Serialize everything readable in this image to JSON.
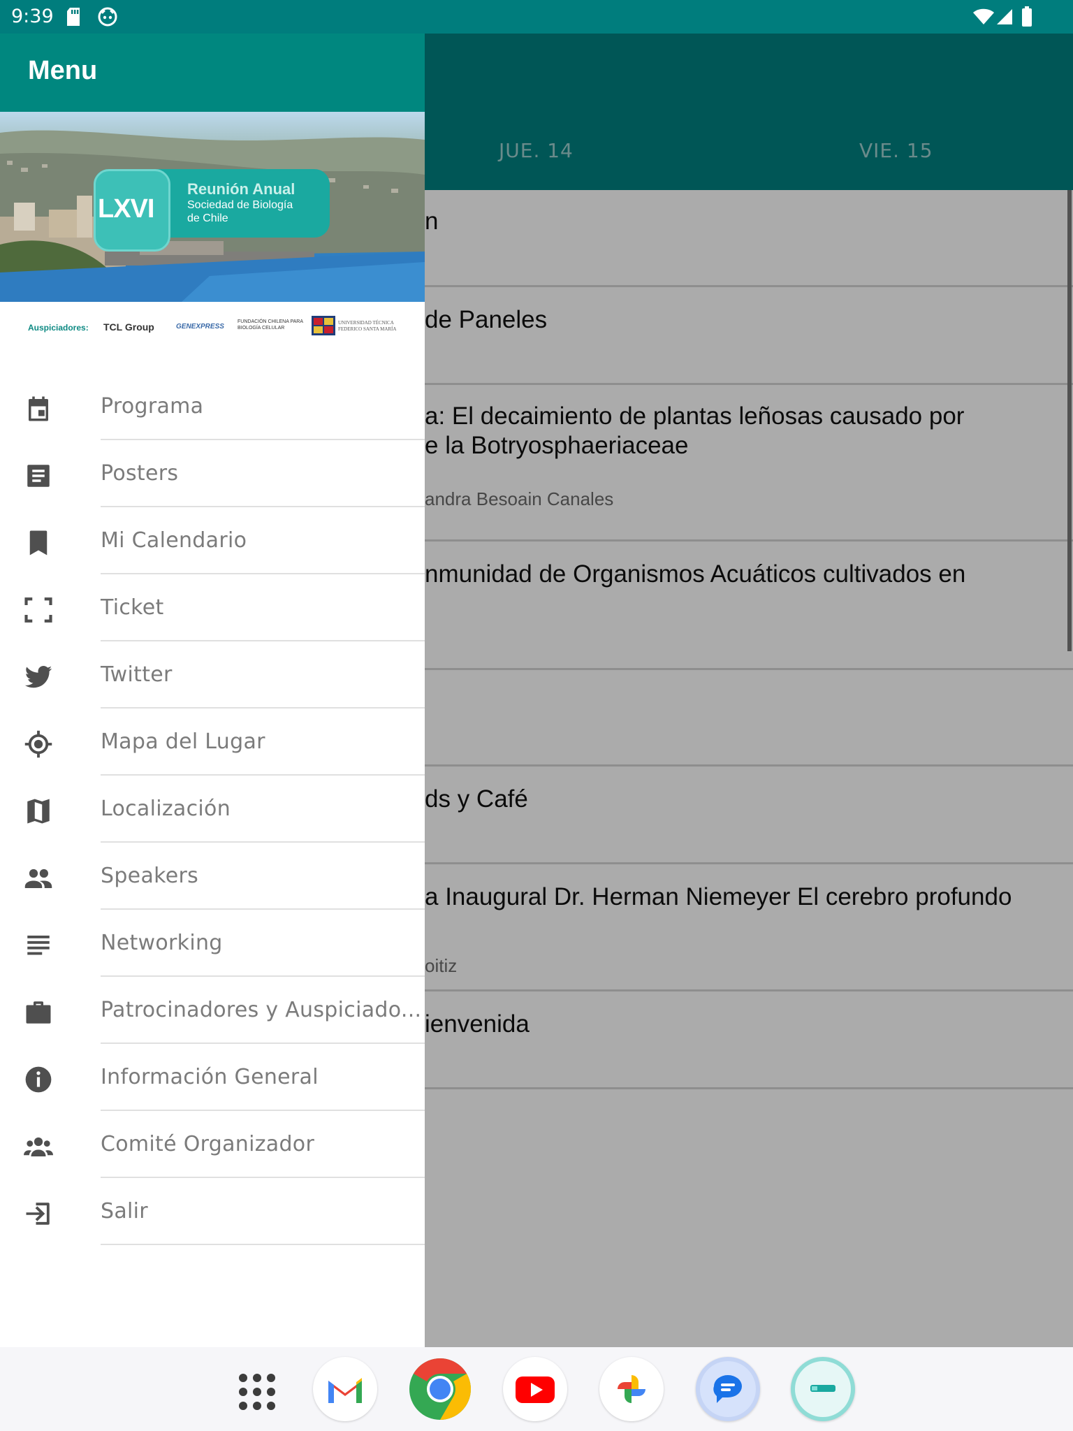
{
  "status_bar": {
    "time": "9:39",
    "icons": [
      "sd-card-icon",
      "notification-icon",
      "wifi-icon",
      "signal-icon",
      "battery-icon"
    ]
  },
  "drawer": {
    "title": "Menu",
    "banner": {
      "badge": "LXVI",
      "line1": "Reunión Anual",
      "line2": "Sociedad de Biología",
      "line3": "de Chile"
    },
    "sponsors": {
      "label": "Auspiciadores:",
      "items": [
        "TCL Group",
        "GENEXPRESS",
        "FUNDACIÓN CHILENA PARA BIOLOGÍA CELULAR",
        "UNIVERSIDAD TÉCNICA FEDERICO SANTA MARÍA"
      ]
    },
    "items": [
      {
        "label": "Programa",
        "icon": "calendar-icon"
      },
      {
        "label": "Posters",
        "icon": "document-icon"
      },
      {
        "label": "Mi Calendario",
        "icon": "bookmark-icon"
      },
      {
        "label": "Ticket",
        "icon": "scan-frame-icon"
      },
      {
        "label": "Twitter",
        "icon": "twitter-icon"
      },
      {
        "label": "Mapa del Lugar",
        "icon": "location-target-icon"
      },
      {
        "label": "Localización",
        "icon": "map-icon"
      },
      {
        "label": "Speakers",
        "icon": "people-icon"
      },
      {
        "label": "Networking",
        "icon": "lines-icon"
      },
      {
        "label": "Patrocinadores y Auspiciado...",
        "icon": "briefcase-icon"
      },
      {
        "label": "Información General",
        "icon": "info-icon"
      },
      {
        "label": "Comité Organizador",
        "icon": "group-icon"
      },
      {
        "label": "Salir",
        "icon": "exit-icon"
      }
    ]
  },
  "background": {
    "tabs": [
      "JUE. 14",
      "VIE. 15"
    ],
    "rows": [
      {
        "title": "n",
        "subtitle": ""
      },
      {
        "title": "de Paneles",
        "subtitle": ""
      },
      {
        "title": "a: El decaimiento de plantas leñosas causado por",
        "title2": "e la Botryosphaeriaceae",
        "subtitle": "andra Besoain Canales"
      },
      {
        "title": "nmunidad de Organismos Acuáticos cultivados en",
        "subtitle": ""
      },
      {
        "title": "",
        "subtitle": ""
      },
      {
        "title": "ds y Café",
        "subtitle": ""
      },
      {
        "title": "a Inaugural Dr. Herman Niemeyer El cerebro profundo",
        "subtitle": "oitiz"
      },
      {
        "title": "ienvenida",
        "subtitle": ""
      }
    ]
  },
  "dock": {
    "apps": [
      "app-drawer",
      "Gmail",
      "Chrome",
      "YouTube",
      "Photos",
      "Messages",
      "Event app"
    ]
  }
}
